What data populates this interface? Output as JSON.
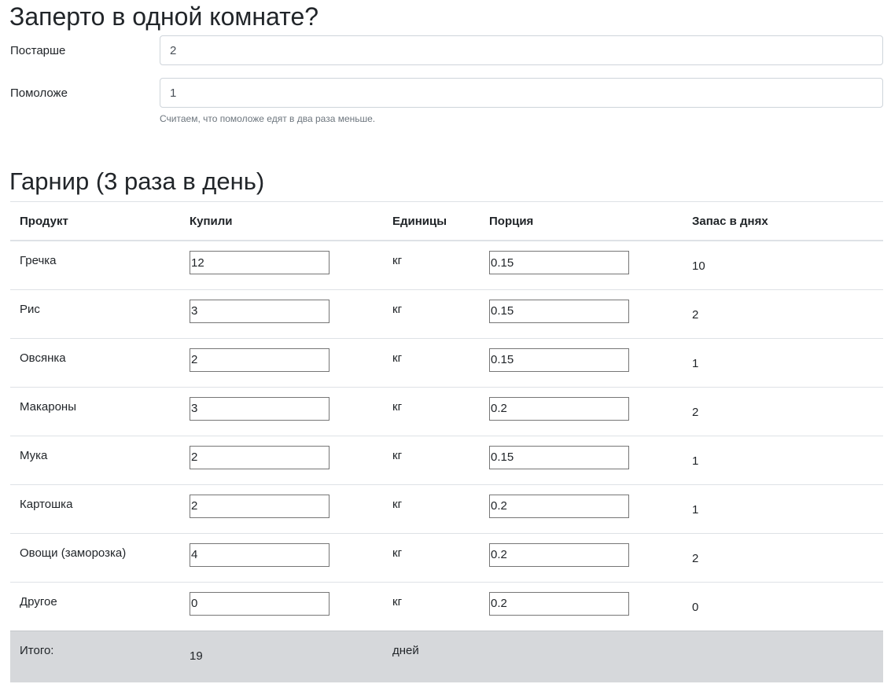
{
  "header": {
    "title": "Заперто в одной комнате?"
  },
  "people": {
    "older_label": "Постарше",
    "older_value": "2",
    "younger_label": "Помоложе",
    "younger_value": "1",
    "help_text": "Считаем, что помоложе едят в два раза меньше."
  },
  "garnish": {
    "title": "Гарнир (3 раза в день)",
    "columns": [
      "Продукт",
      "Купили",
      "Единицы",
      "Порция",
      "Запас в днях"
    ],
    "rows": [
      {
        "product": "Гречка",
        "bought": "12",
        "unit": "кг",
        "portion": "0.15",
        "days": "10"
      },
      {
        "product": "Рис",
        "bought": "3",
        "unit": "кг",
        "portion": "0.15",
        "days": "2"
      },
      {
        "product": "Овсянка",
        "bought": "2",
        "unit": "кг",
        "portion": "0.15",
        "days": "1"
      },
      {
        "product": "Макароны",
        "bought": "3",
        "unit": "кг",
        "portion": "0.2",
        "days": "2"
      },
      {
        "product": "Мука",
        "bought": "2",
        "unit": "кг",
        "portion": "0.15",
        "days": "1"
      },
      {
        "product": "Картошка",
        "bought": "2",
        "unit": "кг",
        "portion": "0.2",
        "days": "1"
      },
      {
        "product": "Овощи (заморозка)",
        "bought": "4",
        "unit": "кг",
        "portion": "0.2",
        "days": "2"
      },
      {
        "product": "Другое",
        "bought": "0",
        "unit": "кг",
        "portion": "0.2",
        "days": "0"
      }
    ],
    "total": {
      "label": "Итого:",
      "value": "19",
      "unit": "дней"
    }
  }
}
